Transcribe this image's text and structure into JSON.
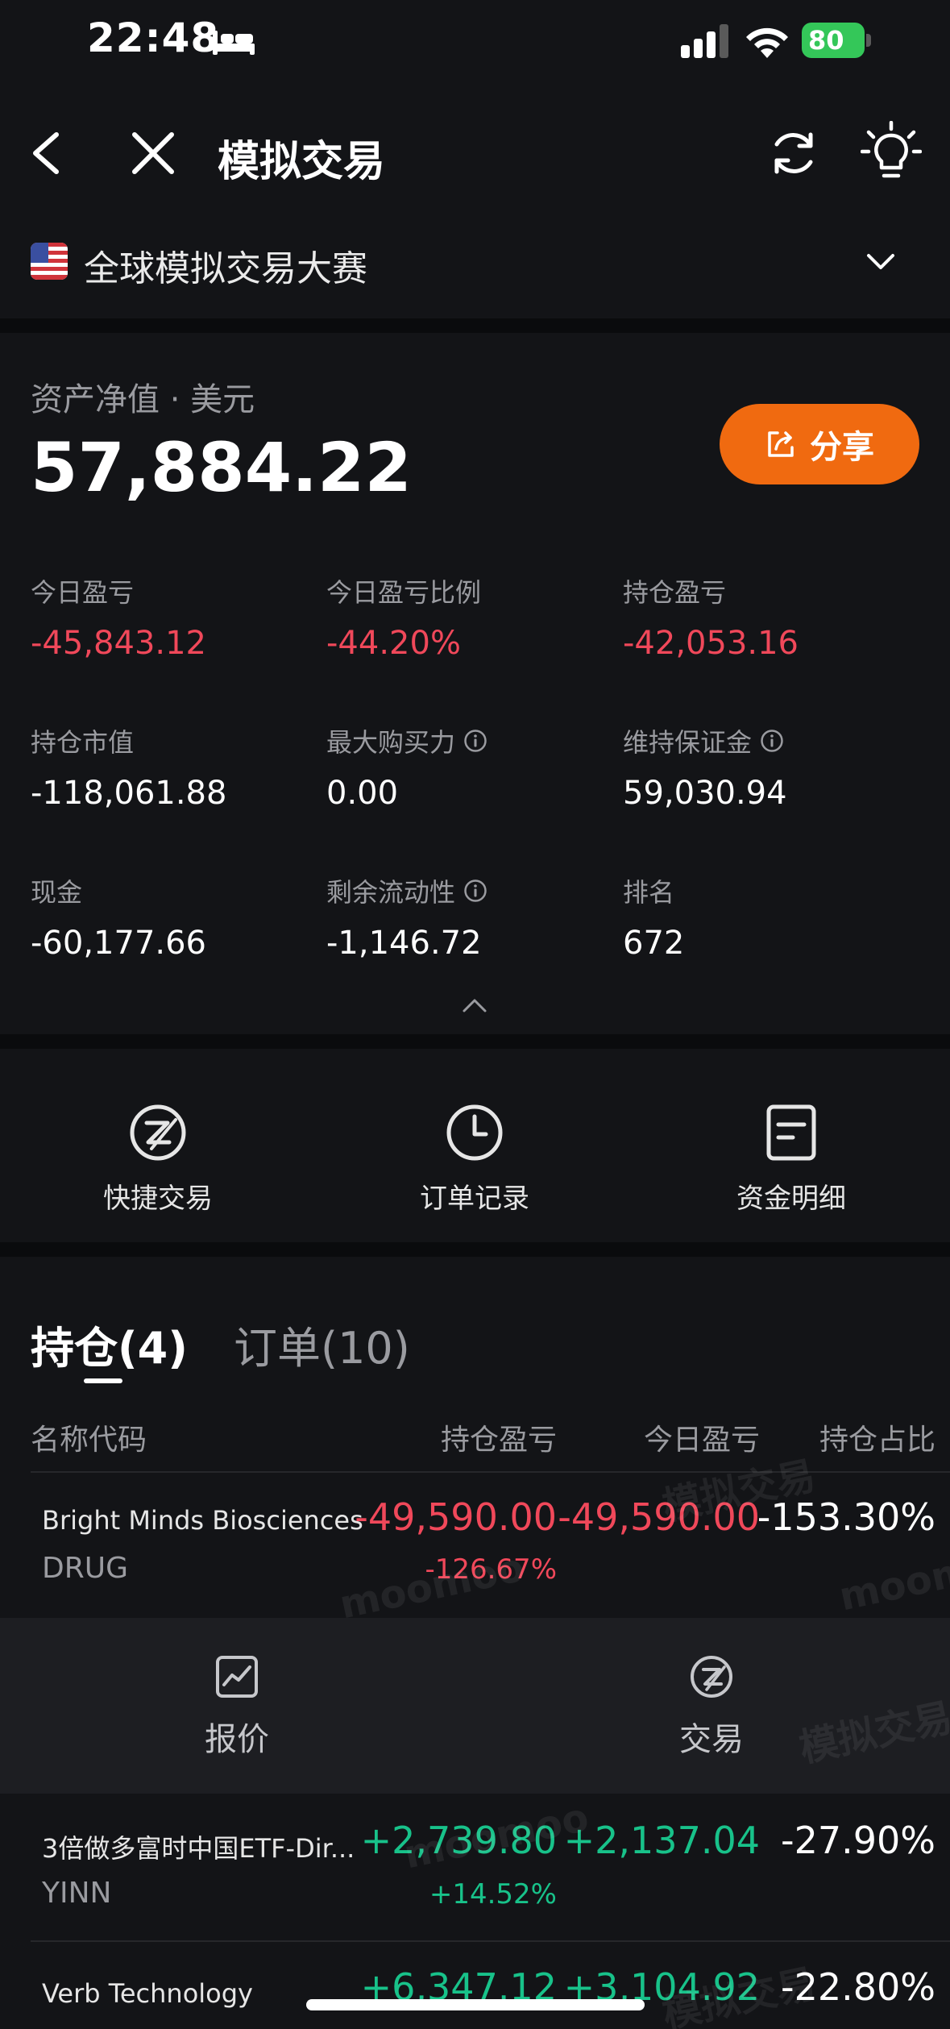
{
  "status_bar": {
    "time": "22:48",
    "battery": "80"
  },
  "nav": {
    "title": "模拟交易"
  },
  "competition": {
    "name": "全球模拟交易大赛"
  },
  "asset": {
    "label": "资产净值 · 美元",
    "value": "57,884.22",
    "share_label": "分享"
  },
  "metrics": [
    {
      "label": "今日盈亏",
      "value": "-45,843.12"
    },
    {
      "label": "今日盈亏比例",
      "value": "-44.20%"
    },
    {
      "label": "持仓盈亏",
      "value": "-42,053.16"
    },
    {
      "label": "持仓市值",
      "value": "-118,061.88"
    },
    {
      "label": "最大购买力",
      "value": "0.00"
    },
    {
      "label": "维持保证金",
      "value": "59,030.94"
    },
    {
      "label": "现金",
      "value": "-60,177.66"
    },
    {
      "label": "剩余流动性",
      "value": "-1,146.72"
    },
    {
      "label": "排名",
      "value": "672"
    }
  ],
  "actions": [
    {
      "label": "快捷交易",
      "icon": "quick-trade-icon"
    },
    {
      "label": "订单记录",
      "icon": "clock-icon"
    },
    {
      "label": "资金明细",
      "icon": "document-icon"
    }
  ],
  "tabs": {
    "positions": "持仓(4)",
    "orders": "订单(10)"
  },
  "table": {
    "headers": [
      "名称代码",
      "持仓盈亏",
      "今日盈亏",
      "持仓占比"
    ],
    "rows": [
      {
        "name": "Bright Minds Biosciences",
        "code": "DRUG",
        "pos_pl": "-49,590.00",
        "pos_pl_pct": "-126.67%",
        "today_pl": "-49,590.00",
        "ratio": "-153.30%"
      },
      {
        "name": "3倍做多富时中国ETF-Dir...",
        "code": "YINN",
        "pos_pl": "+2,739.80",
        "pos_pl_pct": "+14.52%",
        "today_pl": "+2,137.04",
        "ratio": "-27.90%"
      },
      {
        "name": "Verb Technology",
        "code": "",
        "pos_pl": "+6,347.12",
        "pos_pl_pct": "",
        "today_pl": "+3,104.92",
        "ratio": "-22.80%"
      }
    ]
  },
  "panel": {
    "quote": "报价",
    "trade": "交易"
  },
  "watermark": {
    "text": "模拟交易",
    "brand": "moomoo"
  },
  "colors": {
    "negative": "#f0485a",
    "positive": "#18c28a",
    "accent": "#f06a10"
  }
}
